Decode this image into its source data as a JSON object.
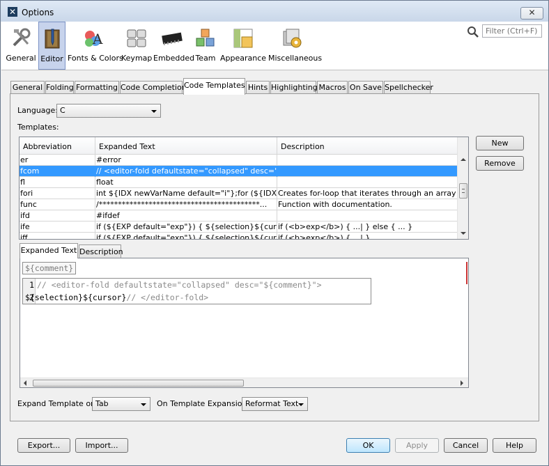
{
  "window": {
    "title": "Options",
    "close_symbol": "✕"
  },
  "search": {
    "placeholder": "Filter (Ctrl+F)"
  },
  "categories": [
    {
      "label": "General",
      "icon": "tools-icon"
    },
    {
      "label": "Editor",
      "icon": "editor-book-icon"
    },
    {
      "label": "Fonts & Colors",
      "icon": "fonts-colors-icon"
    },
    {
      "label": "Keymap",
      "icon": "keymap-icon"
    },
    {
      "label": "Embedded",
      "icon": "chip-icon"
    },
    {
      "label": "Team",
      "icon": "team-cubes-icon"
    },
    {
      "label": "Appearance",
      "icon": "appearance-icon"
    },
    {
      "label": "Miscellaneous",
      "icon": "misc-gear-icon"
    }
  ],
  "tabs": [
    "General",
    "Folding",
    "Formatting",
    "Code Completion",
    "Code Templates",
    "Hints",
    "Highlighting",
    "Macros",
    "On Save",
    "Spellchecker"
  ],
  "active_tab": "Code Templates",
  "language": {
    "label": "Language:",
    "value": "C"
  },
  "templates_label": "Templates:",
  "table": {
    "headers": [
      "Abbreviation",
      "Expanded Text",
      "Description"
    ],
    "rows": [
      {
        "abbr": "er",
        "text": "#error",
        "desc": ""
      },
      {
        "abbr": "fcom",
        "text": "// <editor-fold defaultstate=\"collapsed\" desc=\"${c...",
        "desc": ""
      },
      {
        "abbr": "fl",
        "text": "float",
        "desc": ""
      },
      {
        "abbr": "fori",
        "text": "int ${IDX newVarName default=\"i\"};for (${IDX} = ...",
        "desc": "Creates for-loop that iterates through an array of ..."
      },
      {
        "abbr": "func",
        "text": "   /******************************************...",
        "desc": "Function with documentation."
      },
      {
        "abbr": "ifd",
        "text": "#ifdef",
        "desc": ""
      },
      {
        "abbr": "ife",
        "text": "if (${EXP default=\"exp\"}) {   ${selection}${cursor}...",
        "desc": "if (<b>exp</b>) { ...| } else { ... }"
      },
      {
        "abbr": "iff",
        "text": "if (${EXP default=\"exp\"}) {   ${selection}${cursor}...",
        "desc": "if (<b>exp</b>) { ...| }"
      }
    ]
  },
  "buttons": {
    "new": "New",
    "remove": "Remove",
    "export": "Export...",
    "import": "Import...",
    "ok": "OK",
    "apply": "Apply",
    "cancel": "Cancel",
    "help": "Help"
  },
  "subtabs": [
    "Expanded Text",
    "Description"
  ],
  "editor": {
    "param": "${comment}",
    "lines": [
      {
        "num": "1",
        "code": "// <editor-fold defaultstate=\"collapsed\" desc=\"${comment}\">"
      },
      {
        "num": "2",
        "code_a": "${selection}${cursor}",
        "code_b": "// </editor-fold>"
      }
    ]
  },
  "expand_on": {
    "label": "Expand Template on:",
    "value": "Tab"
  },
  "on_expansion": {
    "label": "On Template Expansion:",
    "value": "Reformat Text"
  }
}
